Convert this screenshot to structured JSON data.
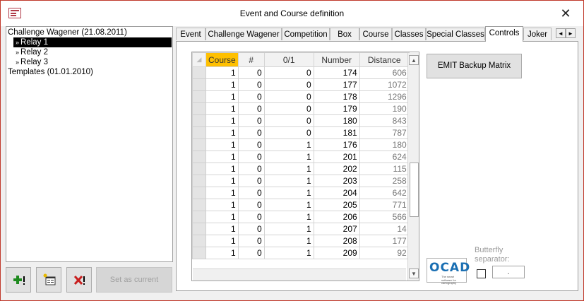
{
  "window": {
    "title": "Event and Course definition",
    "close_glyph": "✕",
    "icon": "form-window-icon"
  },
  "tree": {
    "items": [
      {
        "label": "Challenge Wagener (21.08.2011)",
        "level": 0,
        "selected": false
      },
      {
        "label": "Relay 1",
        "level": 1,
        "selected": true
      },
      {
        "label": "Relay 2",
        "level": 1,
        "selected": false
      },
      {
        "label": "Relay 3",
        "level": 1,
        "selected": false
      },
      {
        "label": "Templates (01.01.2010)",
        "level": 0,
        "selected": false
      }
    ],
    "arrow_glyph": "»"
  },
  "buttons": {
    "add_icon": "add-green-plus-icon",
    "copy_icon": "copy-form-icon",
    "delete_icon": "delete-red-x-icon",
    "set_current": "Set as current"
  },
  "tabs": [
    {
      "label": "Event",
      "active": false
    },
    {
      "label": "Challenge Wagener",
      "active": false
    },
    {
      "label": "Competition",
      "active": false
    },
    {
      "label": "Box",
      "active": false
    },
    {
      "label": "Course",
      "active": false
    },
    {
      "label": "Classes",
      "active": false
    },
    {
      "label": "Special Classes",
      "active": false
    },
    {
      "label": "Controls",
      "active": true
    },
    {
      "label": "Joker",
      "active": false
    }
  ],
  "tab_scroll": {
    "left": "◄",
    "right": "►"
  },
  "grid": {
    "columns": [
      "Course",
      "#",
      "0/1",
      "Number",
      "Distance"
    ],
    "sorted_column": "Course",
    "rows": [
      [
        "1",
        "0",
        "0",
        "174",
        "606"
      ],
      [
        "1",
        "0",
        "0",
        "177",
        "1072"
      ],
      [
        "1",
        "0",
        "0",
        "178",
        "1296"
      ],
      [
        "1",
        "0",
        "0",
        "179",
        "190"
      ],
      [
        "1",
        "0",
        "0",
        "180",
        "843"
      ],
      [
        "1",
        "0",
        "0",
        "181",
        "787"
      ],
      [
        "1",
        "0",
        "1",
        "176",
        "180"
      ],
      [
        "1",
        "0",
        "1",
        "201",
        "624"
      ],
      [
        "1",
        "0",
        "1",
        "202",
        "115"
      ],
      [
        "1",
        "0",
        "1",
        "203",
        "258"
      ],
      [
        "1",
        "0",
        "1",
        "204",
        "642"
      ],
      [
        "1",
        "0",
        "1",
        "205",
        "771"
      ],
      [
        "1",
        "0",
        "1",
        "206",
        "566"
      ],
      [
        "1",
        "0",
        "1",
        "207",
        "14"
      ],
      [
        "1",
        "0",
        "1",
        "208",
        "177"
      ],
      [
        "1",
        "0",
        "1",
        "209",
        "92"
      ]
    ],
    "scroll_up": "▲",
    "scroll_down": "▼"
  },
  "emit_button": "EMIT Backup Matrix",
  "ocad": {
    "logo": "OCAD",
    "tagline": "The smart software for cartography"
  },
  "butterfly": {
    "label": "Butterfly separator:",
    "value": "."
  },
  "colors": {
    "sorted_header": "#ffc000",
    "window_border": "#c0392b",
    "ocad_blue": "#1a6fb3"
  }
}
